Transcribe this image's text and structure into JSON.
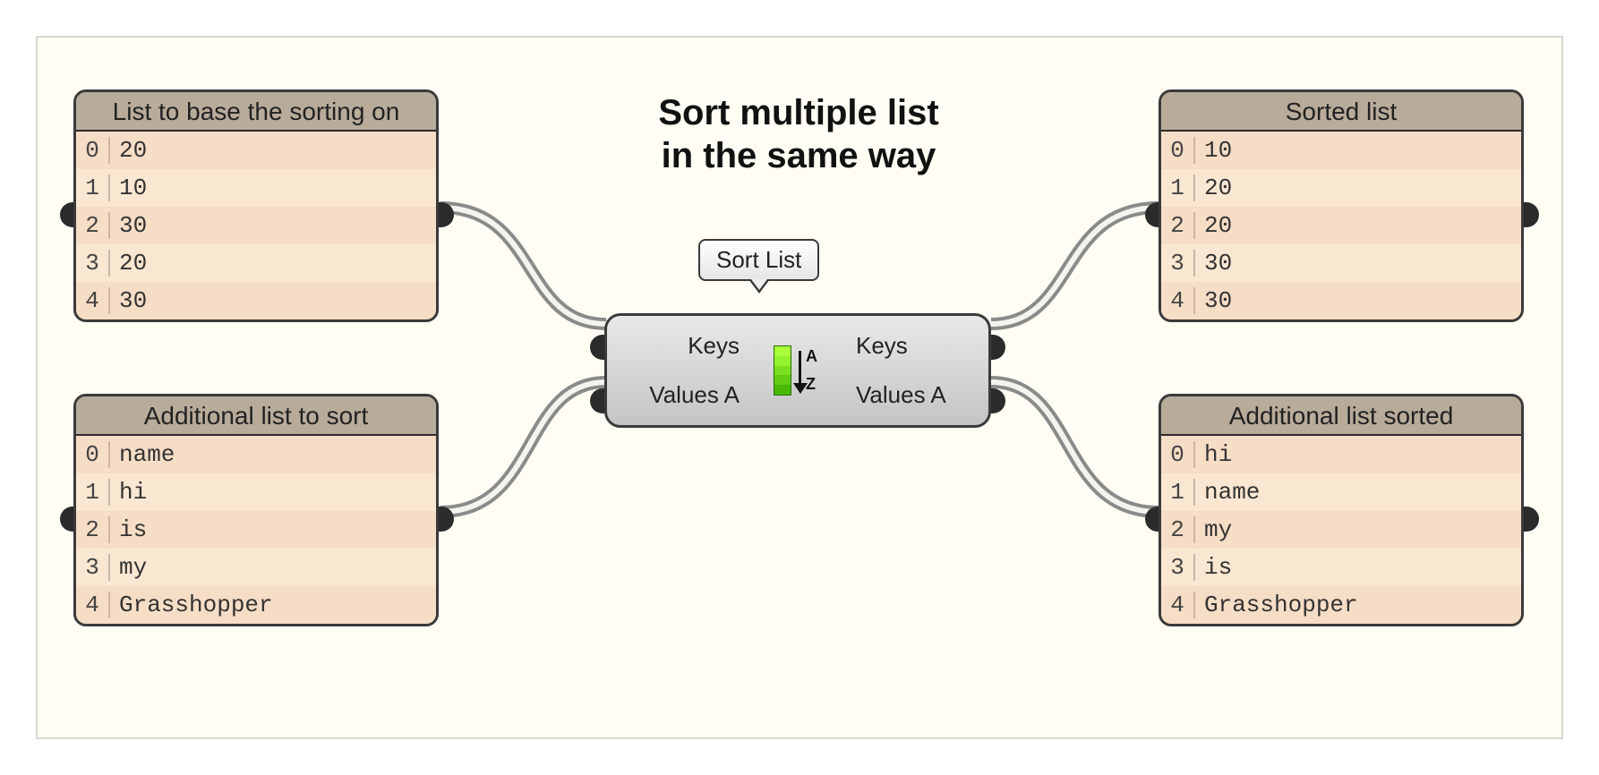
{
  "heading_line1": "Sort multiple list",
  "heading_line2": "in the same way",
  "tooltip_label": "Sort List",
  "sort_component": {
    "in_keys": "Keys",
    "in_values": "Values A",
    "out_keys": "Keys",
    "out_values": "Values A",
    "icon_name": "sort-az-icon"
  },
  "panels": {
    "source_keys": {
      "title": "List to base the sorting on",
      "rows": [
        {
          "idx": "0",
          "val": "20"
        },
        {
          "idx": "1",
          "val": "10"
        },
        {
          "idx": "2",
          "val": "30"
        },
        {
          "idx": "3",
          "val": "20"
        },
        {
          "idx": "4",
          "val": "30"
        }
      ]
    },
    "source_values": {
      "title": "Additional list to sort",
      "rows": [
        {
          "idx": "0",
          "val": "name"
        },
        {
          "idx": "1",
          "val": "hi"
        },
        {
          "idx": "2",
          "val": "is"
        },
        {
          "idx": "3",
          "val": "my"
        },
        {
          "idx": "4",
          "val": "Grasshopper"
        }
      ]
    },
    "sorted_keys": {
      "title": "Sorted list",
      "rows": [
        {
          "idx": "0",
          "val": "10"
        },
        {
          "idx": "1",
          "val": "20"
        },
        {
          "idx": "2",
          "val": "20"
        },
        {
          "idx": "3",
          "val": "30"
        },
        {
          "idx": "4",
          "val": "30"
        }
      ]
    },
    "sorted_values": {
      "title": "Additional list sorted",
      "rows": [
        {
          "idx": "0",
          "val": "hi"
        },
        {
          "idx": "1",
          "val": "name"
        },
        {
          "idx": "2",
          "val": "my"
        },
        {
          "idx": "3",
          "val": "is"
        },
        {
          "idx": "4",
          "val": "Grasshopper"
        }
      ]
    }
  }
}
